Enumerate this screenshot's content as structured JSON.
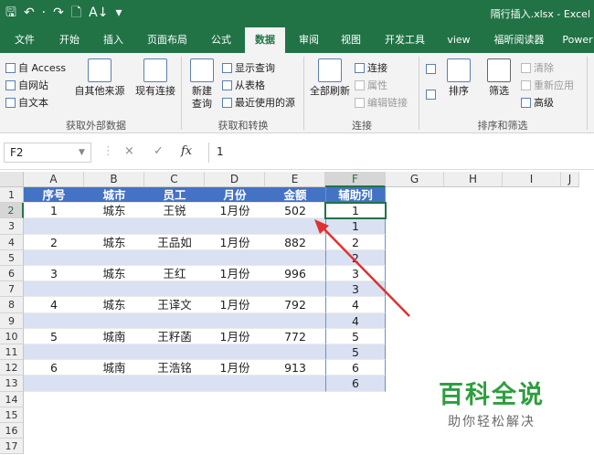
{
  "title_bar": {
    "quick_access": [
      "🖫",
      "↶",
      "·",
      "↷",
      "🗋",
      "A↓",
      "▾"
    ],
    "document_title": "隔行插入.xlsx - Excel"
  },
  "tabs": [
    "文件",
    "开始",
    "插入",
    "页面布局",
    "公式",
    "数据",
    "审阅",
    "视图",
    "开发工具",
    "view",
    "福昕阅读器",
    "Power"
  ],
  "active_tab": "数据",
  "ribbon": {
    "get_external": {
      "access": "自 Access",
      "web": "自网站",
      "text": "自文本",
      "other": "自其他来源",
      "existing": "现有连接",
      "group_label": "获取外部数据"
    },
    "transform": {
      "new_query": "新建\n查询",
      "show_queries": "显示查询",
      "from_table": "从表格",
      "recent_sources": "最近使用的源",
      "group_label": "获取和转换"
    },
    "connections": {
      "refresh_all": "全部刷新",
      "connections": "连接",
      "properties": "属性",
      "edit_links": "编辑链接",
      "group_label": "连接"
    },
    "sort_filter": {
      "sort": "排序",
      "filter": "筛选",
      "clear": "清除",
      "reapply": "重新应用",
      "advanced": "高级",
      "group_label": "排序和筛选"
    }
  },
  "formula_bar": {
    "name_box": "F2",
    "cancel": "×",
    "enter": "✓",
    "fx": "fx",
    "formula": "1"
  },
  "sheet": {
    "columns": [
      "A",
      "B",
      "C",
      "D",
      "E",
      "F",
      "G",
      "H",
      "I",
      "J"
    ],
    "selected_column": "F",
    "rows": [
      "1",
      "2",
      "3",
      "4",
      "5",
      "6",
      "7",
      "8",
      "9",
      "10",
      "11",
      "12",
      "13",
      "14",
      "15",
      "16",
      "17"
    ],
    "selected_row": "2",
    "header_fill": "#4472c4",
    "band_fill": "#d9e1f2",
    "header": [
      "序号",
      "城市",
      "员工",
      "月份",
      "金额",
      "辅助列"
    ],
    "data_rows": [
      [
        "1",
        "城东",
        "王锐",
        "1月份",
        "502",
        "1"
      ],
      [
        "",
        "",
        "",
        "",
        "",
        "1"
      ],
      [
        "2",
        "城东",
        "王品如",
        "1月份",
        "882",
        "2"
      ],
      [
        "",
        "",
        "",
        "",
        "",
        "2"
      ],
      [
        "3",
        "城东",
        "王红",
        "1月份",
        "996",
        "3"
      ],
      [
        "",
        "",
        "",
        "",
        "",
        "3"
      ],
      [
        "4",
        "城东",
        "王译文",
        "1月份",
        "792",
        "4"
      ],
      [
        "",
        "",
        "",
        "",
        "",
        "4"
      ],
      [
        "5",
        "城南",
        "王籽菡",
        "1月份",
        "772",
        "5"
      ],
      [
        "",
        "",
        "",
        "",
        "",
        "5"
      ],
      [
        "6",
        "城南",
        "王浩铭",
        "1月份",
        "913",
        "6"
      ],
      [
        "",
        "",
        "",
        "",
        "",
        "6"
      ]
    ],
    "active_cell": "F2"
  },
  "annotation": {
    "arrow_color": "#e03030"
  },
  "watermark": {
    "main": "百科全说",
    "sub": "助你轻松解决"
  }
}
